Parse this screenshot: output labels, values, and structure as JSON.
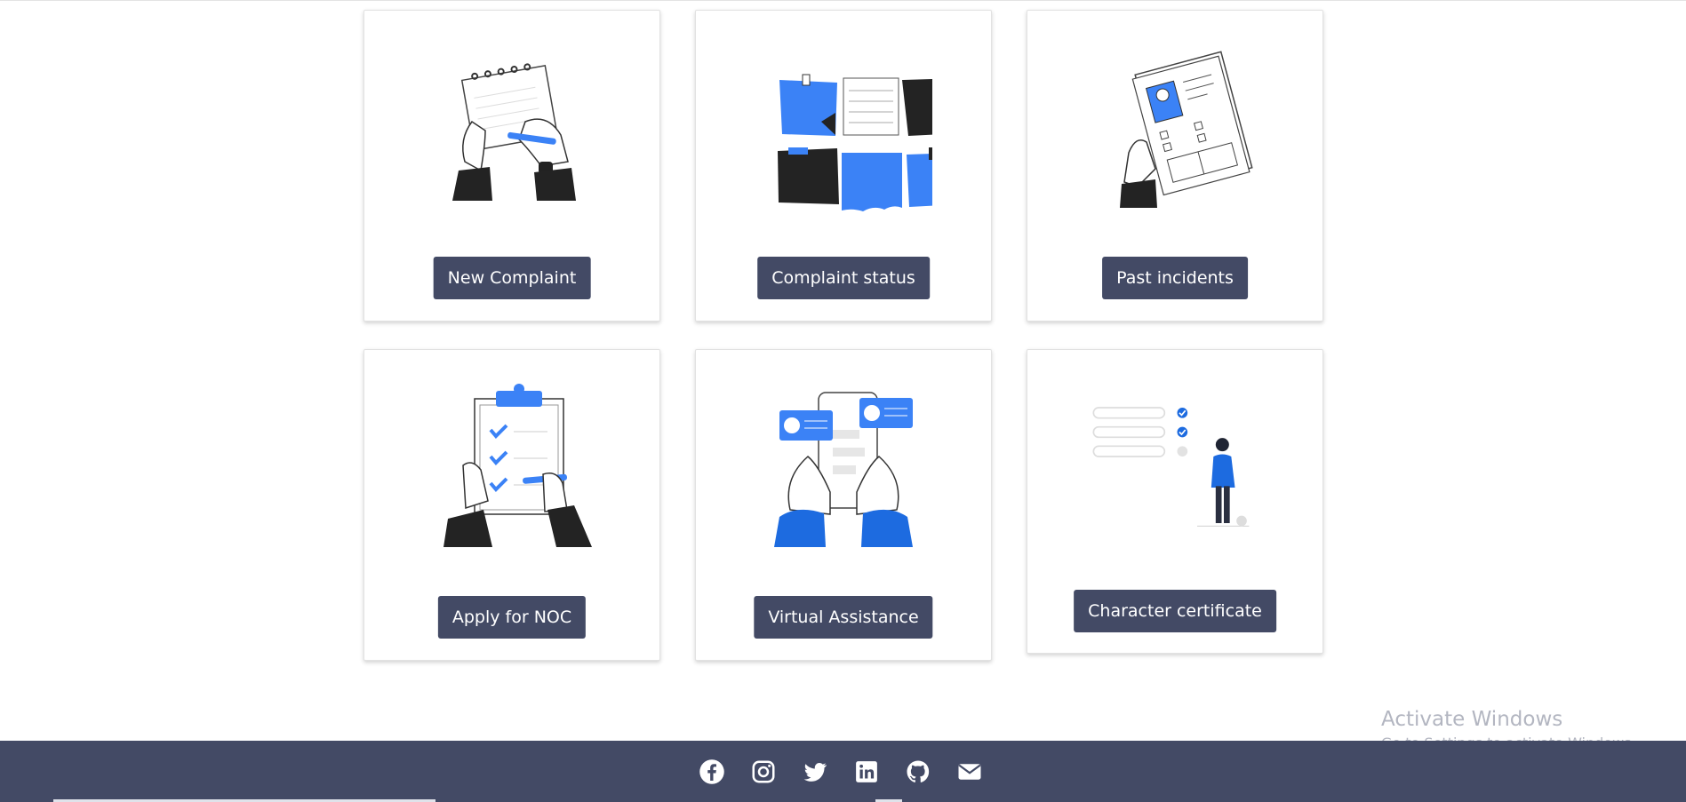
{
  "cards": [
    {
      "label": "New Complaint",
      "illustration": "notepad-writing-icon"
    },
    {
      "label": "Complaint status",
      "illustration": "sticky-notes-icon"
    },
    {
      "label": "Past incidents",
      "illustration": "document-resume-icon"
    },
    {
      "label": "Apply for NOC",
      "illustration": "clipboard-checklist-icon"
    },
    {
      "label": "Virtual Assistance",
      "illustration": "phone-chat-icon"
    },
    {
      "label": "Character certificate",
      "illustration": "checklist-person-icon"
    }
  ],
  "footer": {
    "icons": [
      "facebook-icon",
      "instagram-icon",
      "twitter-icon",
      "linkedin-icon",
      "github-icon",
      "email-icon"
    ]
  },
  "watermark": {
    "title": "Activate Windows",
    "subtitle": "Go to Settings to activate Windows."
  },
  "colors": {
    "accent": "#3b82f6",
    "button_bg": "#434a65",
    "footer_bg": "#434a65",
    "dark_fill": "#232323"
  }
}
